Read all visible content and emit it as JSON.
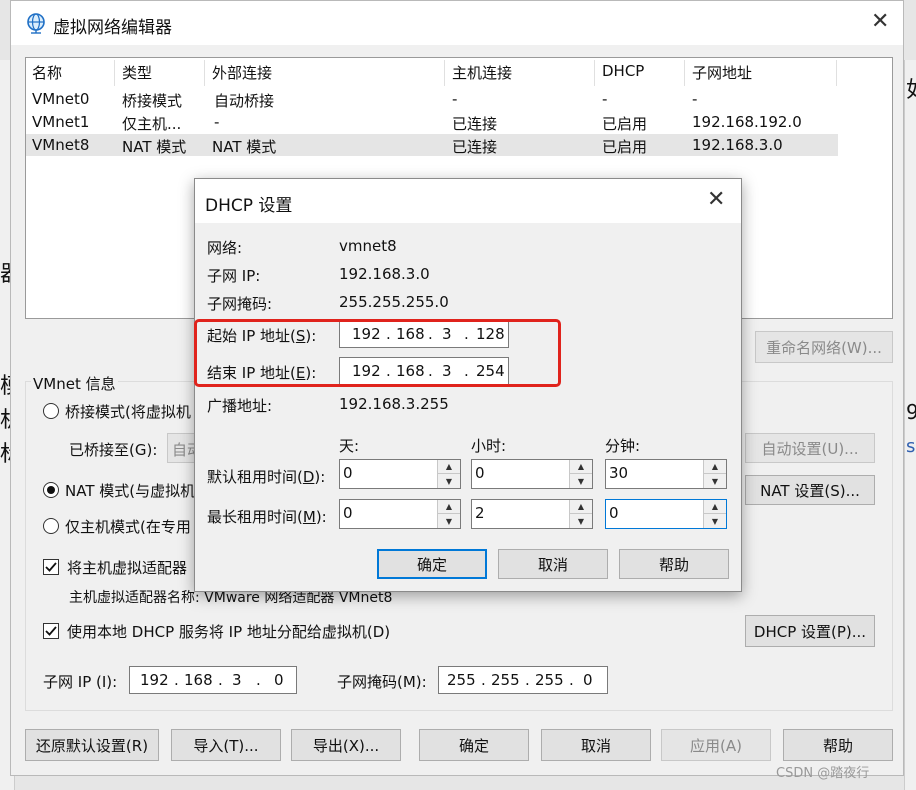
{
  "window": {
    "title": "虚拟网络编辑器",
    "close_glyph": "✕"
  },
  "network_table": {
    "columns": [
      "名称",
      "类型",
      "外部连接",
      "主机连接",
      "DHCP",
      "子网地址"
    ],
    "rows": [
      [
        "VMnet0",
        "桥接模式",
        "自动桥接",
        "-",
        "-",
        "-"
      ],
      [
        "VMnet1",
        "仅主机...",
        "-",
        "已连接",
        "已启用",
        "192.168.192.0"
      ],
      [
        "VMnet8",
        "NAT 模式",
        "NAT 模式",
        "已连接",
        "已启用",
        "192.168.3.0"
      ]
    ]
  },
  "rename_button": "重命名网络(W)...",
  "vmnet_info": {
    "legend": "VMnet 信息",
    "bridged_label": "桥接模式(将虚拟机",
    "bridged_to_label": "已桥接至(G):",
    "bridged_to_value": "自动",
    "auto_settings_button": "自动设置(U)...",
    "nat_label": "NAT 模式(与虚拟机",
    "nat_settings_button": "NAT 设置(S)...",
    "hostonly_label": "仅主机模式(在专用",
    "connect_adapter_label": "将主机虚拟适配器",
    "adapter_name_text": "主机虚拟适配器名称: VMware 网络适配器 VMnet8",
    "use_dhcp_label": "使用本地 DHCP 服务将 IP 地址分配给虚拟机(D)",
    "dhcp_settings_button": "DHCP 设置(P)...",
    "subnet_ip_label": "子网 IP (I):",
    "subnet_ip": [
      "192",
      "168",
      "3",
      "0"
    ],
    "subnet_mask_label": "子网掩码(M):",
    "subnet_mask": [
      "255",
      "255",
      "255",
      "0"
    ]
  },
  "bottom_buttons": {
    "restore": "还原默认设置(R)",
    "import": "导入(T)...",
    "export": "导出(X)...",
    "ok": "确定",
    "cancel": "取消",
    "apply": "应用(A)",
    "help": "帮助"
  },
  "dhcp_dialog": {
    "title": "DHCP 设置",
    "network_label": "网络:",
    "network_value": "vmnet8",
    "subnet_ip_label": "子网 IP:",
    "subnet_ip_value": "192.168.3.0",
    "subnet_mask_label": "子网掩码:",
    "subnet_mask_value": "255.255.255.0",
    "start_ip_label_pre": "起始 IP 地址(",
    "start_ip_key": "S",
    "start_ip_label_post": "):",
    "start_ip": [
      "192",
      "168",
      "3",
      "128"
    ],
    "end_ip_label_pre": "结束 IP 地址(",
    "end_ip_key": "E",
    "end_ip_label_post": "):",
    "end_ip": [
      "192",
      "168",
      "3",
      "254"
    ],
    "broadcast_label": "广播地址:",
    "broadcast_value": "192.168.3.255",
    "col_days": "天:",
    "col_hours": "小时:",
    "col_minutes": "分钟:",
    "default_lease_pre": "默认租用时间(",
    "default_lease_key": "D",
    "default_lease_post": "):",
    "default_lease": [
      "0",
      "0",
      "30"
    ],
    "max_lease_pre": "最长租用时间(",
    "max_lease_key": "M",
    "max_lease_post": "):",
    "max_lease": [
      "0",
      "2",
      "0"
    ],
    "ok": "确定",
    "cancel": "取消",
    "help": "帮助"
  },
  "watermark": "CSDN @踏夜行",
  "background_fragments": [
    "器",
    "模",
    "机",
    "标",
    "如",
    "9",
    "s."
  ]
}
